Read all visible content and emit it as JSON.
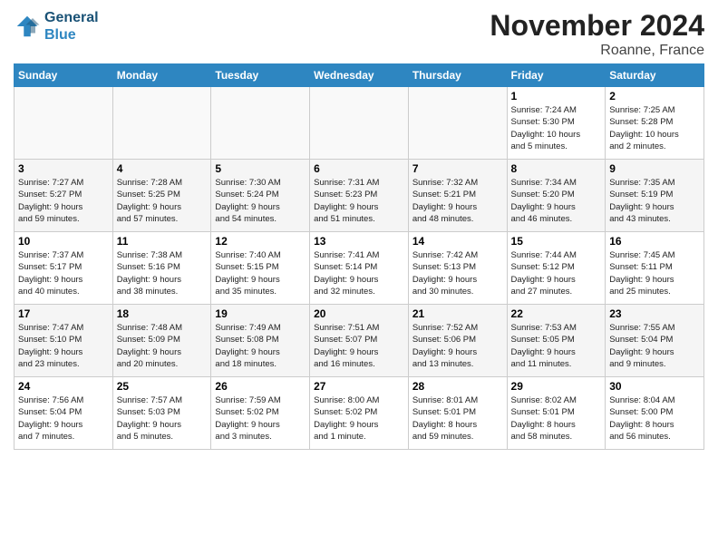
{
  "logo": {
    "line1": "General",
    "line2": "Blue"
  },
  "title": "November 2024",
  "location": "Roanne, France",
  "headers": [
    "Sunday",
    "Monday",
    "Tuesday",
    "Wednesday",
    "Thursday",
    "Friday",
    "Saturday"
  ],
  "weeks": [
    [
      {
        "day": "",
        "info": ""
      },
      {
        "day": "",
        "info": ""
      },
      {
        "day": "",
        "info": ""
      },
      {
        "day": "",
        "info": ""
      },
      {
        "day": "",
        "info": ""
      },
      {
        "day": "1",
        "info": "Sunrise: 7:24 AM\nSunset: 5:30 PM\nDaylight: 10 hours\nand 5 minutes."
      },
      {
        "day": "2",
        "info": "Sunrise: 7:25 AM\nSunset: 5:28 PM\nDaylight: 10 hours\nand 2 minutes."
      }
    ],
    [
      {
        "day": "3",
        "info": "Sunrise: 7:27 AM\nSunset: 5:27 PM\nDaylight: 9 hours\nand 59 minutes."
      },
      {
        "day": "4",
        "info": "Sunrise: 7:28 AM\nSunset: 5:25 PM\nDaylight: 9 hours\nand 57 minutes."
      },
      {
        "day": "5",
        "info": "Sunrise: 7:30 AM\nSunset: 5:24 PM\nDaylight: 9 hours\nand 54 minutes."
      },
      {
        "day": "6",
        "info": "Sunrise: 7:31 AM\nSunset: 5:23 PM\nDaylight: 9 hours\nand 51 minutes."
      },
      {
        "day": "7",
        "info": "Sunrise: 7:32 AM\nSunset: 5:21 PM\nDaylight: 9 hours\nand 48 minutes."
      },
      {
        "day": "8",
        "info": "Sunrise: 7:34 AM\nSunset: 5:20 PM\nDaylight: 9 hours\nand 46 minutes."
      },
      {
        "day": "9",
        "info": "Sunrise: 7:35 AM\nSunset: 5:19 PM\nDaylight: 9 hours\nand 43 minutes."
      }
    ],
    [
      {
        "day": "10",
        "info": "Sunrise: 7:37 AM\nSunset: 5:17 PM\nDaylight: 9 hours\nand 40 minutes."
      },
      {
        "day": "11",
        "info": "Sunrise: 7:38 AM\nSunset: 5:16 PM\nDaylight: 9 hours\nand 38 minutes."
      },
      {
        "day": "12",
        "info": "Sunrise: 7:40 AM\nSunset: 5:15 PM\nDaylight: 9 hours\nand 35 minutes."
      },
      {
        "day": "13",
        "info": "Sunrise: 7:41 AM\nSunset: 5:14 PM\nDaylight: 9 hours\nand 32 minutes."
      },
      {
        "day": "14",
        "info": "Sunrise: 7:42 AM\nSunset: 5:13 PM\nDaylight: 9 hours\nand 30 minutes."
      },
      {
        "day": "15",
        "info": "Sunrise: 7:44 AM\nSunset: 5:12 PM\nDaylight: 9 hours\nand 27 minutes."
      },
      {
        "day": "16",
        "info": "Sunrise: 7:45 AM\nSunset: 5:11 PM\nDaylight: 9 hours\nand 25 minutes."
      }
    ],
    [
      {
        "day": "17",
        "info": "Sunrise: 7:47 AM\nSunset: 5:10 PM\nDaylight: 9 hours\nand 23 minutes."
      },
      {
        "day": "18",
        "info": "Sunrise: 7:48 AM\nSunset: 5:09 PM\nDaylight: 9 hours\nand 20 minutes."
      },
      {
        "day": "19",
        "info": "Sunrise: 7:49 AM\nSunset: 5:08 PM\nDaylight: 9 hours\nand 18 minutes."
      },
      {
        "day": "20",
        "info": "Sunrise: 7:51 AM\nSunset: 5:07 PM\nDaylight: 9 hours\nand 16 minutes."
      },
      {
        "day": "21",
        "info": "Sunrise: 7:52 AM\nSunset: 5:06 PM\nDaylight: 9 hours\nand 13 minutes."
      },
      {
        "day": "22",
        "info": "Sunrise: 7:53 AM\nSunset: 5:05 PM\nDaylight: 9 hours\nand 11 minutes."
      },
      {
        "day": "23",
        "info": "Sunrise: 7:55 AM\nSunset: 5:04 PM\nDaylight: 9 hours\nand 9 minutes."
      }
    ],
    [
      {
        "day": "24",
        "info": "Sunrise: 7:56 AM\nSunset: 5:04 PM\nDaylight: 9 hours\nand 7 minutes."
      },
      {
        "day": "25",
        "info": "Sunrise: 7:57 AM\nSunset: 5:03 PM\nDaylight: 9 hours\nand 5 minutes."
      },
      {
        "day": "26",
        "info": "Sunrise: 7:59 AM\nSunset: 5:02 PM\nDaylight: 9 hours\nand 3 minutes."
      },
      {
        "day": "27",
        "info": "Sunrise: 8:00 AM\nSunset: 5:02 PM\nDaylight: 9 hours\nand 1 minute."
      },
      {
        "day": "28",
        "info": "Sunrise: 8:01 AM\nSunset: 5:01 PM\nDaylight: 8 hours\nand 59 minutes."
      },
      {
        "day": "29",
        "info": "Sunrise: 8:02 AM\nSunset: 5:01 PM\nDaylight: 8 hours\nand 58 minutes."
      },
      {
        "day": "30",
        "info": "Sunrise: 8:04 AM\nSunset: 5:00 PM\nDaylight: 8 hours\nand 56 minutes."
      }
    ]
  ]
}
